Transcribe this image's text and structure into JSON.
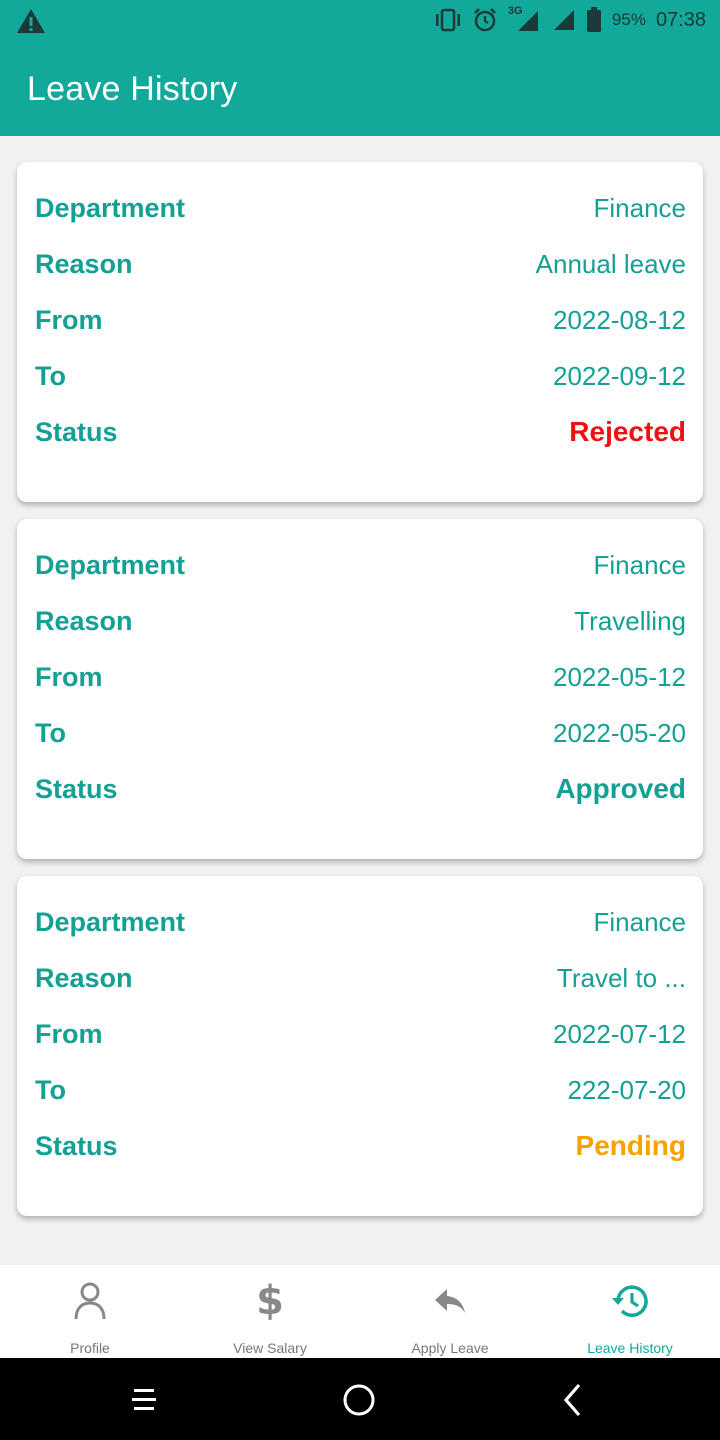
{
  "status_bar": {
    "network": "3G",
    "battery": "95%",
    "time": "07:38"
  },
  "header": {
    "title": "Leave History"
  },
  "labels": {
    "department": "Department",
    "reason": "Reason",
    "from": "From",
    "to": "To",
    "status": "Status"
  },
  "leaves": [
    {
      "department": "Finance",
      "reason": "Annual leave",
      "from": "2022-08-12",
      "to": "2022-09-12",
      "status": "Rejected"
    },
    {
      "department": "Finance",
      "reason": "Travelling",
      "from": "2022-05-12",
      "to": "2022-05-20",
      "status": "Approved"
    },
    {
      "department": "Finance",
      "reason": "Travel to ...",
      "from": "2022-07-12",
      "to": "222-07-20",
      "status": "Pending"
    }
  ],
  "status_colors": {
    "Rejected": "#ee1111",
    "Approved": "#14a093",
    "Pending": "#f8a200"
  },
  "bottom_nav": {
    "items": [
      {
        "label": "Profile",
        "icon": "person-icon",
        "active": false
      },
      {
        "label": "View Salary",
        "icon": "dollar-icon",
        "active": false
      },
      {
        "label": "Apply Leave",
        "icon": "reply-icon",
        "active": false
      },
      {
        "label": "Leave History",
        "icon": "history-icon",
        "active": true
      }
    ]
  },
  "colors": {
    "primary": "#12a89a",
    "text_primary": "#14a093",
    "inactive": "#888888"
  }
}
